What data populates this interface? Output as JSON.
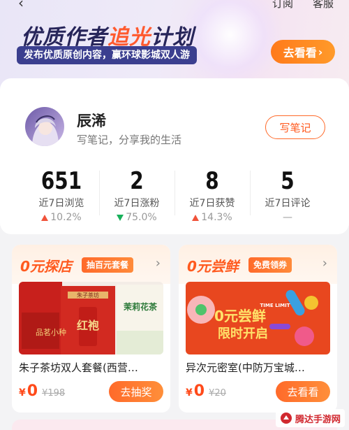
{
  "top_nav": {
    "links": [
      "订阅",
      "客服"
    ]
  },
  "banner": {
    "title_main": "优质作者",
    "title_accent": "追光",
    "title_end": "计划",
    "subtitle": "发布优质原创内容，赢环球影城双人游",
    "button_label": "去看看",
    "button_arrow": "›"
  },
  "profile": {
    "name": "辰浠",
    "bio": "写笔记，分享我的生活",
    "note_button": "写笔记"
  },
  "stats": [
    {
      "value": "651",
      "label": "近7日浏览",
      "change": "10.2%",
      "trend": "up"
    },
    {
      "value": "2",
      "label": "近7日涨粉",
      "change": "75.0%",
      "trend": "down"
    },
    {
      "value": "8",
      "label": "近7日获赞",
      "change": "14.3%",
      "trend": "up"
    },
    {
      "value": "5",
      "label": "近7日评论",
      "change": "—",
      "trend": "none"
    }
  ],
  "promos": [
    {
      "title": "0元探店",
      "tag": "抽百元套餐",
      "name": "朱子茶坊双人套餐(西营…",
      "price_symbol": "¥",
      "price": "0",
      "original_price": "¥198",
      "button": "去抽奖"
    },
    {
      "title": "0元尝鲜",
      "tag": "免费领券",
      "name": "异次元密室(中防万宝城…",
      "price_symbol": "¥",
      "price": "0",
      "original_price": "¥20",
      "button": "去看看"
    }
  ],
  "promo_images": {
    "left_labels": [
      "红袍",
      "茉莉花茶",
      "朱子茶坊",
      "品茗小种"
    ],
    "right_labels": [
      "0元尝鲜",
      "限时开启",
      "TIME LIMIT"
    ]
  },
  "watermark": "腾达手游网",
  "colors": {
    "accent": "#ff5a1f",
    "up": "#f0523a",
    "down": "#18b05a",
    "banner_dark": "#27255a"
  }
}
